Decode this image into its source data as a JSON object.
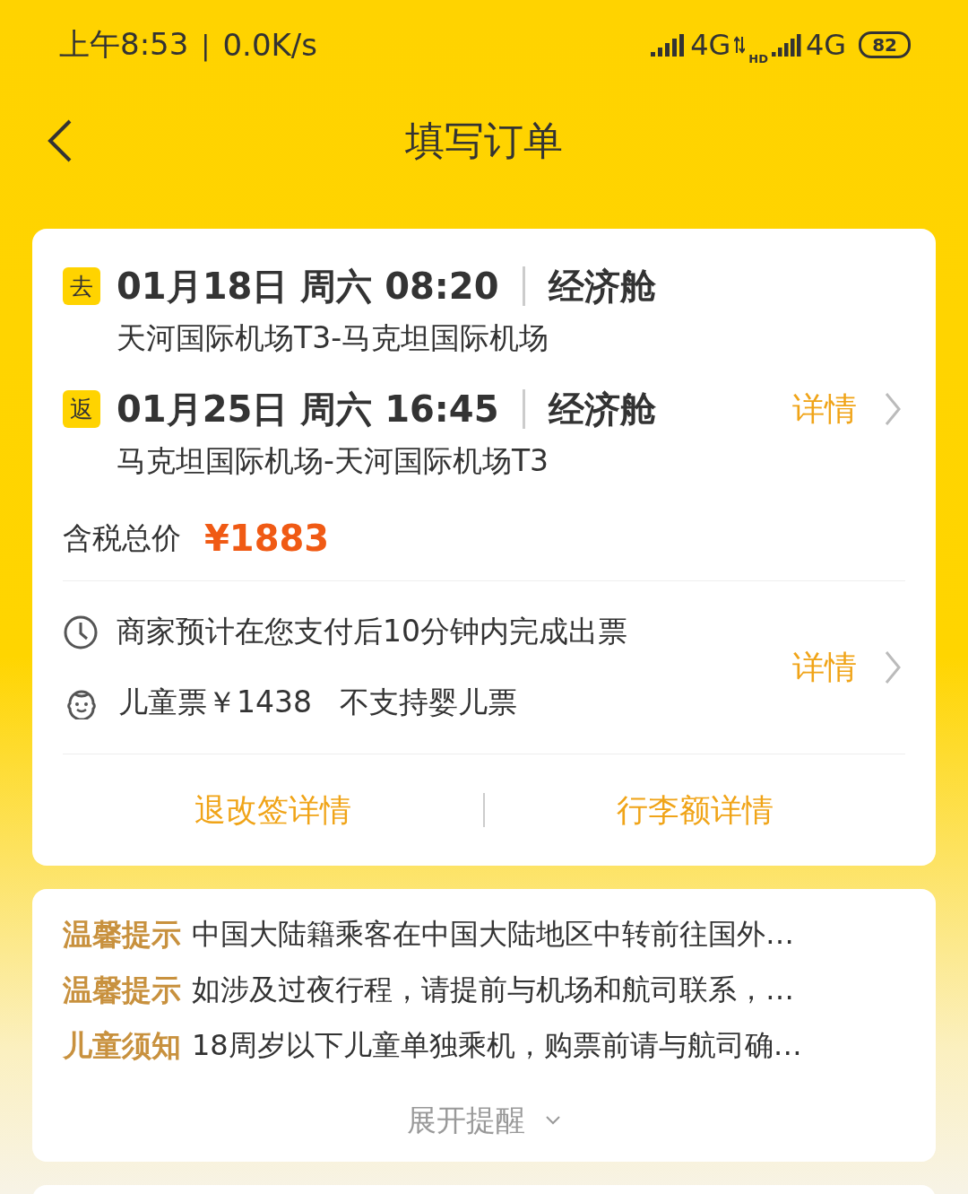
{
  "status_bar": {
    "time": "上午8:53",
    "separator": "|",
    "speed": "0.0K/s",
    "network_1": "4G",
    "network_2": "4G",
    "hd": "HD",
    "battery": "82"
  },
  "header": {
    "title": "填写订单"
  },
  "flights": [
    {
      "tag": "去",
      "datetime": "01月18日 周六 08:20",
      "cabin": "经济舱",
      "route": "天河国际机场T3-马克坦国际机场"
    },
    {
      "tag": "返",
      "datetime": "01月25日 周六 16:45",
      "cabin": "经济舱",
      "route": "马克坦国际机场-天河国际机场T3",
      "detail": "详情"
    }
  ],
  "price": {
    "label": "含税总价",
    "amount": "¥1883"
  },
  "info": {
    "rows": [
      {
        "kind": "clock",
        "text": "商家预计在您支付后10分钟内完成出票"
      },
      {
        "kind": "child",
        "text": "儿童票￥1438   不支持婴儿票"
      }
    ],
    "detail": "详情"
  },
  "links": [
    "退改签详情",
    "行李额详情"
  ],
  "notices": [
    {
      "label": "温馨提示",
      "text": "中国大陆籍乘客在中国大陆地区中转前往国外…"
    },
    {
      "label": "温馨提示",
      "text": "如涉及过夜行程，请提前与机场和航司联系，…"
    },
    {
      "label": "儿童须知",
      "text": "18周岁以下儿童单独乘机，购票前请与航司确…"
    }
  ],
  "expand": "展开提醒"
}
